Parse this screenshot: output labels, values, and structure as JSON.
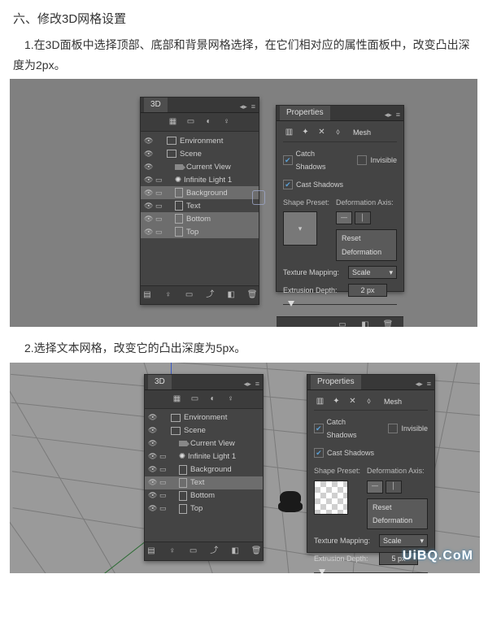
{
  "article": {
    "heading": "六、修改3D网格设置",
    "step1": "1.在3D面板中选择顶部、底部和背景网格选择，在它们相对应的属性面板中，改变凸出深度为2px。",
    "step2": "2.选择文本网格，改变它的凸出深度为5px。"
  },
  "panel3d": {
    "title": "3D",
    "items": [
      {
        "name": "Environment",
        "indent": 0,
        "icon": "env"
      },
      {
        "name": "Scene",
        "indent": 0,
        "icon": "rect"
      },
      {
        "name": "Current View",
        "indent": 1,
        "icon": "cam"
      },
      {
        "name": "Infinite Light 1",
        "indent": 1,
        "icon": "bulb"
      },
      {
        "name": "Background",
        "indent": 1,
        "icon": "sheet"
      },
      {
        "name": "Text",
        "indent": 1,
        "icon": "sheet"
      },
      {
        "name": "Bottom",
        "indent": 1,
        "icon": "sheet"
      },
      {
        "name": "Top",
        "indent": 1,
        "icon": "sheet"
      }
    ],
    "selection_fig1": [
      "Background",
      "Bottom",
      "Top"
    ],
    "selection_fig2": [
      "Text"
    ]
  },
  "properties": {
    "title": "Properties",
    "mesh_label": "Mesh",
    "catch_shadows": "Catch Shadows",
    "cast_shadows": "Cast Shadows",
    "invisible": "Invisible",
    "shape_preset": "Shape Preset:",
    "deformation_axis": "Deformation Axis:",
    "reset": "Reset Deformation",
    "texture_mapping_label": "Texture Mapping:",
    "texture_mapping_value": "Scale",
    "extrusion_label": "Extrusion Depth:",
    "extrusion_value_fig1": "2 px",
    "extrusion_value_fig2": "5 px"
  },
  "watermark": "UiBQ.CoM"
}
